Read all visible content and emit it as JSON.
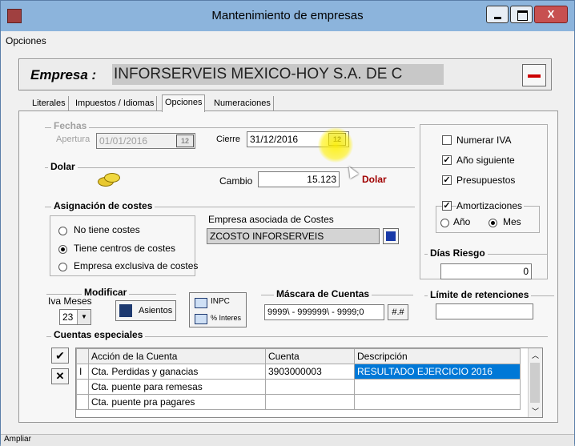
{
  "window": {
    "title": "Mantenimiento de empresas",
    "close_glyph": "X"
  },
  "menu": {
    "opciones": "Opciones"
  },
  "empresa": {
    "label": "Empresa :",
    "name": "INFORSERVEIS MEXICO-HOY S.A. DE C"
  },
  "tabs": [
    "Literales",
    "Impuestos / Idiomas",
    "Opciones",
    "Numeraciones"
  ],
  "fechas": {
    "legend": "Fechas",
    "apertura_label": "Apertura",
    "apertura_value": "01/01/2016",
    "cierre_label": "Cierre",
    "cierre_value": "31/12/2016",
    "cal_glyph": "12"
  },
  "dolar": {
    "legend": "Dolar",
    "cambio_label": "Cambio",
    "cambio_value": "15.123",
    "link": "Dolar"
  },
  "asignacion": {
    "legend": "Asignación de costes",
    "options": [
      "No tiene costes",
      "Tiene centros de costes",
      "Empresa exclusiva de costes"
    ],
    "selected": 1,
    "empresa_asociada_label": "Empresa asociada de Costes",
    "empresa_asociada_value": "ZCOSTO INFORSERVEIS"
  },
  "right": {
    "numerar_iva": "Numerar IVA",
    "ano_siguiente": "Año siguiente",
    "presupuestos": "Presupuestos",
    "amortizaciones": "Amortizaciones",
    "ano": "Año",
    "mes": "Mes",
    "dias_riesgo_label": "Días Riesgo",
    "dias_riesgo_value": "0",
    "limite_label": "Límite de retenciones",
    "limite_value": ""
  },
  "checks": {
    "numerar_iva": false,
    "ano_siguiente": true,
    "presupuestos": true,
    "amortizaciones": true
  },
  "modificar": {
    "legend": "Modificar",
    "iva_meses_label": "Iva Meses",
    "iva_meses_value": "23",
    "asientos": "Asientos",
    "inpc": "INPC",
    "intereses": "% Interes"
  },
  "mascara": {
    "legend": "Máscara de Cuentas",
    "value": "9999\\ - 999999\\ - 9999;0",
    "btn": "#.#"
  },
  "cuentas": {
    "legend": "Cuentas especiales",
    "headers": [
      "Acción de la Cuenta",
      "Cuenta",
      "Descripción"
    ],
    "rows": [
      {
        "marker": "I",
        "accion": "Cta. Perdidas y ganacias",
        "cuenta": "3903000003",
        "descripcion": "RESULTADO EJERCICIO 2016"
      },
      {
        "marker": "",
        "accion": "Cta. puente para remesas",
        "cuenta": "",
        "descripcion": ""
      },
      {
        "marker": "",
        "accion": "Cta. puente pra pagares",
        "cuenta": "",
        "descripcion": ""
      }
    ],
    "ok_glyph": "✔",
    "cancel_glyph": "✕"
  },
  "statusbar": {
    "text": "Ampliar"
  },
  "colors": {
    "accent": "#0078d7",
    "titlebar": "#8cb4dc",
    "close": "#c75050",
    "dolar_link": "#a00000"
  }
}
